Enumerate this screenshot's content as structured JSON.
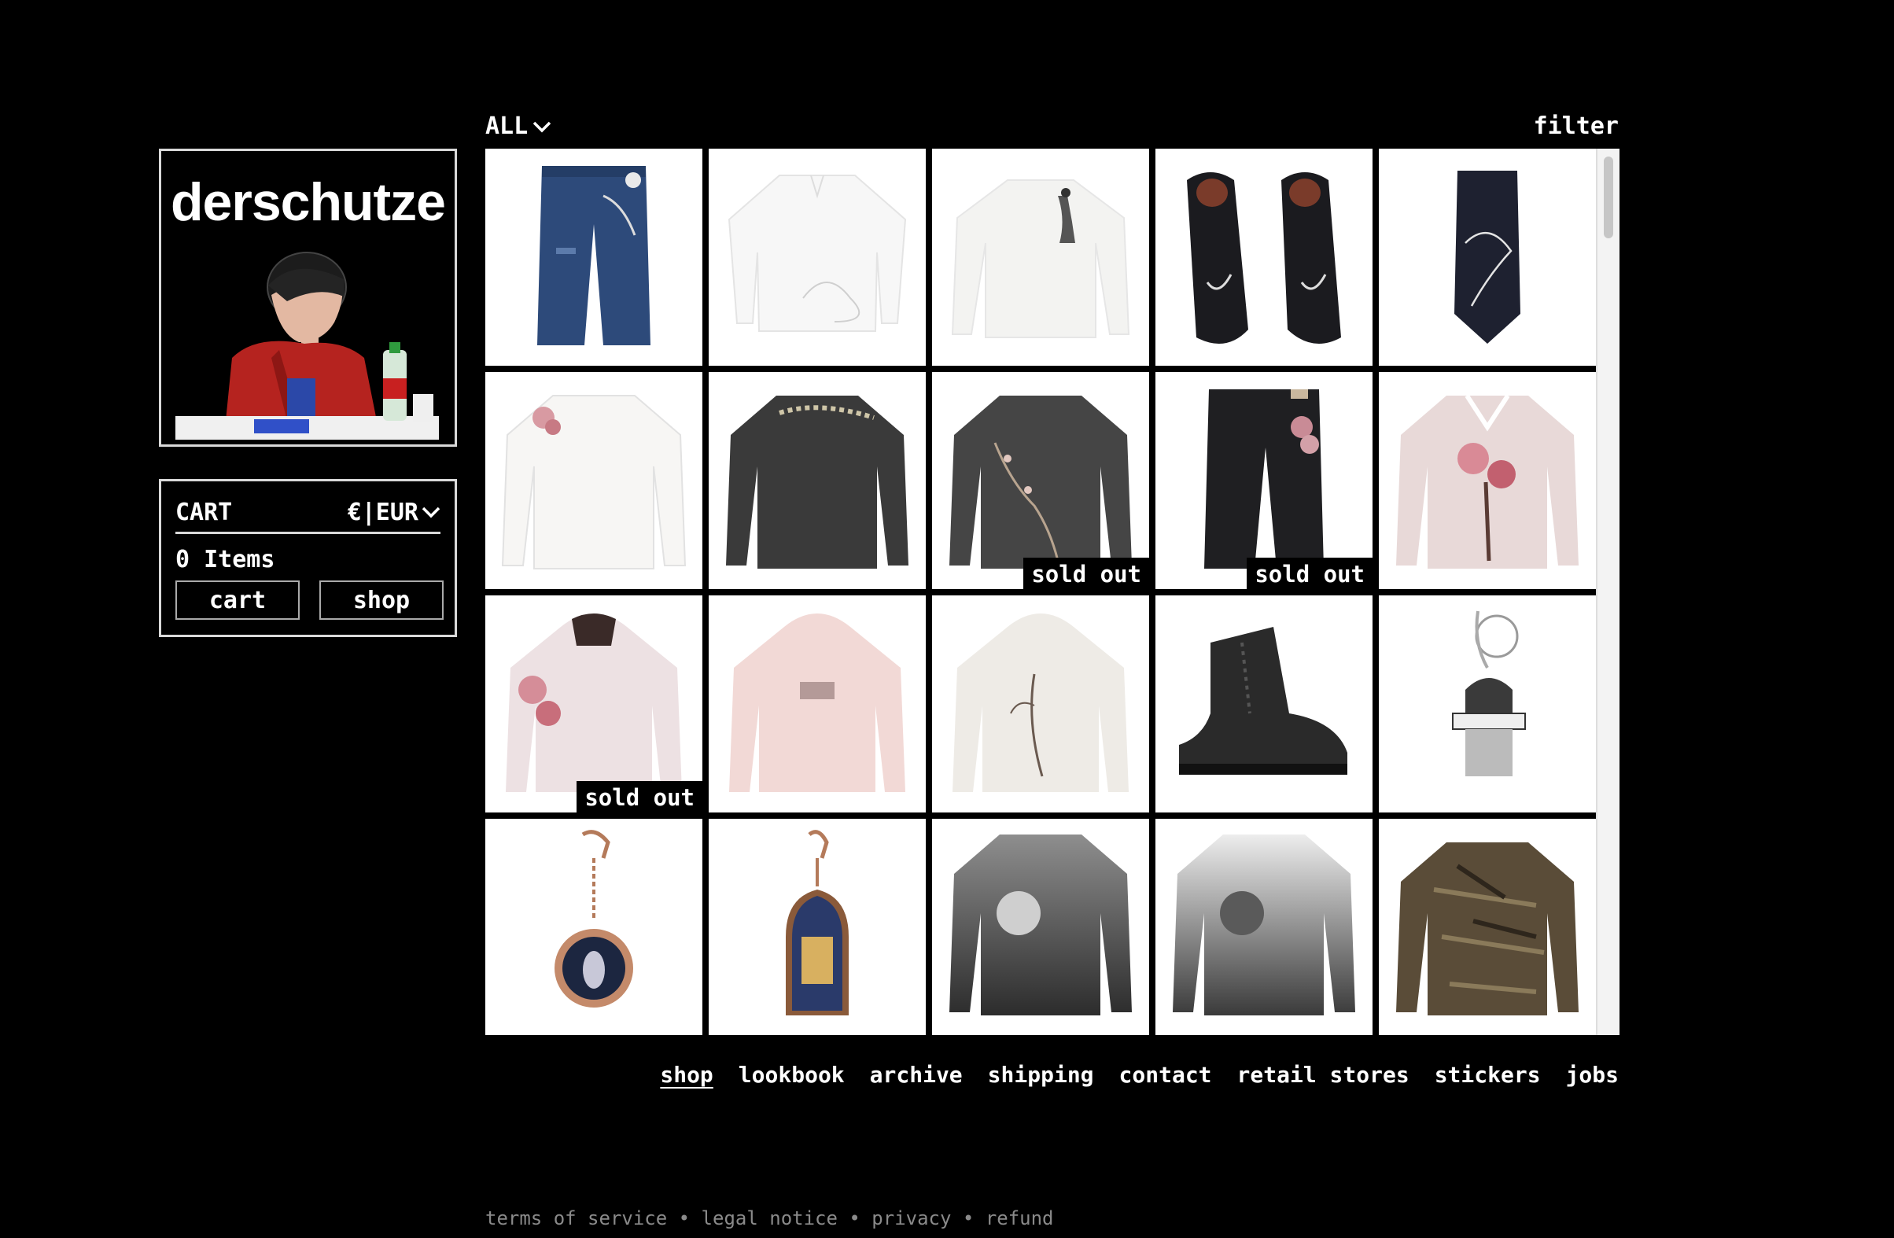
{
  "brand": {
    "name": "derschutze"
  },
  "cart": {
    "title": "CART",
    "currency": "€|EUR",
    "items": "0 Items",
    "cart_label": "cart",
    "shop_label": "shop"
  },
  "toolbar": {
    "category": "ALL",
    "filter": "filter"
  },
  "products": [
    {
      "name": "embroidered denim jeans",
      "sold_out": false
    },
    {
      "name": "white embroidered shirt",
      "sold_out": false
    },
    {
      "name": "white longsleeve with print",
      "sold_out": false
    },
    {
      "name": "black loafers with print",
      "sold_out": false
    },
    {
      "name": "black printed tie",
      "sold_out": false
    },
    {
      "name": "white cherry blossom sweater",
      "sold_out": false
    },
    {
      "name": "charcoal cherry blossom sweater",
      "sold_out": false
    },
    {
      "name": "grey knit blossom sweater",
      "sold_out": true
    },
    {
      "name": "black blossom jeans",
      "sold_out": true
    },
    {
      "name": "pink blossom varsity sweater",
      "sold_out": false
    },
    {
      "name": "pink cherry blossom zip hoodie",
      "sold_out": true
    },
    {
      "name": "pink hoodie",
      "sold_out": false
    },
    {
      "name": "cream blossom hoodie",
      "sold_out": false
    },
    {
      "name": "black woven boot",
      "sold_out": false
    },
    {
      "name": "keychain charm",
      "sold_out": false
    },
    {
      "name": "round pendant keychain",
      "sold_out": false
    },
    {
      "name": "stained glass keychain",
      "sold_out": false
    },
    {
      "name": "dark gradient knit sweater",
      "sold_out": false
    },
    {
      "name": "light gradient knit sweater",
      "sold_out": false
    },
    {
      "name": "brown camo knit sweater",
      "sold_out": false
    }
  ],
  "sold_out_label": "sold out",
  "nav": [
    {
      "label": "shop",
      "active": true
    },
    {
      "label": "lookbook",
      "active": false
    },
    {
      "label": "archive",
      "active": false
    },
    {
      "label": "shipping",
      "active": false
    },
    {
      "label": "contact",
      "active": false
    },
    {
      "label": "retail stores",
      "active": false
    },
    {
      "label": "stickers",
      "active": false
    },
    {
      "label": "jobs",
      "active": false
    }
  ],
  "legal": {
    "terms": "terms of service",
    "notice": "legal notice",
    "privacy": "privacy",
    "refund": "refund"
  },
  "colors": {
    "background": "#000000",
    "text": "#ffffff",
    "muted": "#8a8a8a"
  }
}
